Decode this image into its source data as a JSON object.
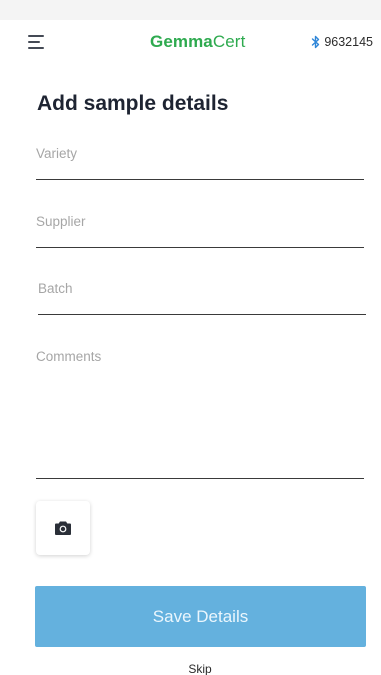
{
  "header": {
    "logo_bold": "Gemma",
    "logo_regular": "Cert",
    "device_id": "9632145",
    "brand_color": "#2eaa4f"
  },
  "page": {
    "title": "Add sample details"
  },
  "form": {
    "variety": {
      "value": "",
      "placeholder": "Variety"
    },
    "supplier": {
      "value": "",
      "placeholder": "Supplier"
    },
    "batch": {
      "value": "",
      "placeholder": "Batch"
    },
    "comments": {
      "value": "",
      "placeholder": "Comments"
    }
  },
  "icons": {
    "menu": "hamburger-menu-icon",
    "bluetooth": "bluetooth-icon",
    "camera": "camera-icon"
  },
  "actions": {
    "save_label": "Save Details",
    "save_color": "#64b1de",
    "skip_label": "Skip"
  }
}
